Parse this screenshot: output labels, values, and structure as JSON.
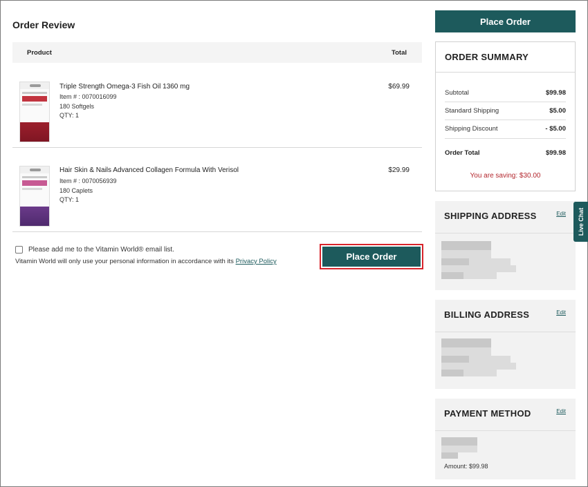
{
  "review": {
    "title": "Order Review",
    "col_product": "Product",
    "col_total": "Total"
  },
  "items": [
    {
      "name": "Triple Strength Omega-3 Fish Oil 1360 mg",
      "item_no": "Item # : 0070016099",
      "count": "180 Softgels",
      "qty": "QTY: 1",
      "price": "$69.99"
    },
    {
      "name": "Hair Skin & Nails Advanced Collagen Formula With Verisol",
      "item_no": "Item # : 0070056939",
      "count": "180 Caplets",
      "qty": "QTY: 1",
      "price": "$29.99"
    }
  ],
  "email_opt": {
    "label": "Please add me to the Vitamin World® email list.",
    "privacy_prefix": "Vitamin World will only use your personal information in accordance with its ",
    "privacy_link": "Privacy Policy"
  },
  "buttons": {
    "place_order_top": "Place Order",
    "place_order_bottom": "Place Order"
  },
  "summary": {
    "title": "ORDER SUMMARY",
    "subtotal_label": "Subtotal",
    "subtotal": "$99.98",
    "shipping_label": "Standard Shipping",
    "shipping": "$5.00",
    "discount_label": "Shipping Discount",
    "discount": "- $5.00",
    "total_label": "Order Total",
    "total": "$99.98",
    "saving": "You are saving: $30.00"
  },
  "shipping_address": {
    "title": "SHIPPING ADDRESS",
    "edit": "Edit"
  },
  "billing_address": {
    "title": "BILLING ADDRESS",
    "edit": "Edit"
  },
  "payment_method": {
    "title": "PAYMENT METHOD",
    "edit": "Edit",
    "amount": "Amount: $99.98"
  },
  "live_chat": "Live Chat",
  "colors": {
    "brand_teal": "#1d5a5c",
    "highlight_red": "#d8232a",
    "saving_red": "#b3262d"
  }
}
